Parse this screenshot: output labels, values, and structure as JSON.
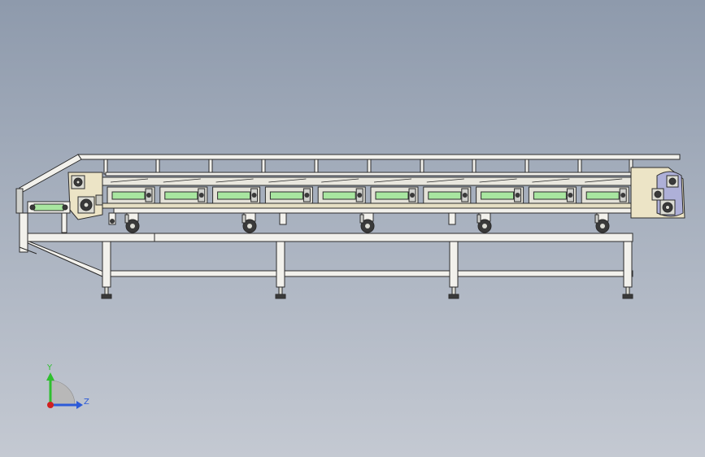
{
  "viewport": {
    "name": "cad-graphics-area"
  },
  "colors": {
    "frame": "#f2f1ec",
    "outline": "#2c2c2c",
    "roller_green": "#a8e6a0",
    "end_plate": "#ece4c6",
    "motor_lilac": "#aeb0d8",
    "axis_y": "#2fbf2f",
    "axis_z": "#2c5ad8",
    "axis_x": "#d02020"
  },
  "icons": {
    "triad": "coordinate-triad-icon",
    "origin": "origin-dot-icon"
  },
  "axes": {
    "y_label": "Y",
    "z_label": "Z"
  },
  "model": {
    "roller_modules": 10,
    "support_wheels": 6,
    "stand_legs": 4
  }
}
